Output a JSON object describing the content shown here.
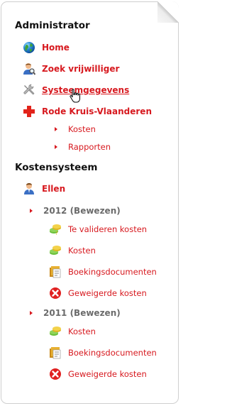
{
  "admin": {
    "heading": "Administrator",
    "items": [
      {
        "label": "Home",
        "icon": "globe-icon"
      },
      {
        "label": "Zoek vrijwilliger",
        "icon": "user-search-icon"
      },
      {
        "label": "Systeemgegevens",
        "icon": "wrench-icon"
      },
      {
        "label": "Rode Kruis-Vlaanderen",
        "icon": "red-cross-icon"
      }
    ],
    "sub_items": [
      "Kosten",
      "Rapporten"
    ]
  },
  "kosten": {
    "heading": "Kostensysteem",
    "user": {
      "label": "Ellen",
      "icon": "user-icon"
    },
    "years": [
      {
        "label": "2012 (Bewezen)",
        "items": [
          {
            "label": "Te valideren kosten",
            "icon": "coins-icon"
          },
          {
            "label": "Kosten",
            "icon": "coins-icon"
          },
          {
            "label": "Boekingsdocumenten",
            "icon": "documents-icon"
          },
          {
            "label": "Geweigerde kosten",
            "icon": "rejected-icon"
          }
        ]
      },
      {
        "label": "2011 (Bewezen)",
        "items": [
          {
            "label": "Kosten",
            "icon": "coins-icon"
          },
          {
            "label": "Boekingsdocumenten",
            "icon": "documents-icon"
          },
          {
            "label": "Geweigerde kosten",
            "icon": "rejected-icon"
          }
        ]
      }
    ]
  },
  "colors": {
    "link": "#d7191f",
    "year": "#6b6b6b",
    "heading": "#111111"
  }
}
